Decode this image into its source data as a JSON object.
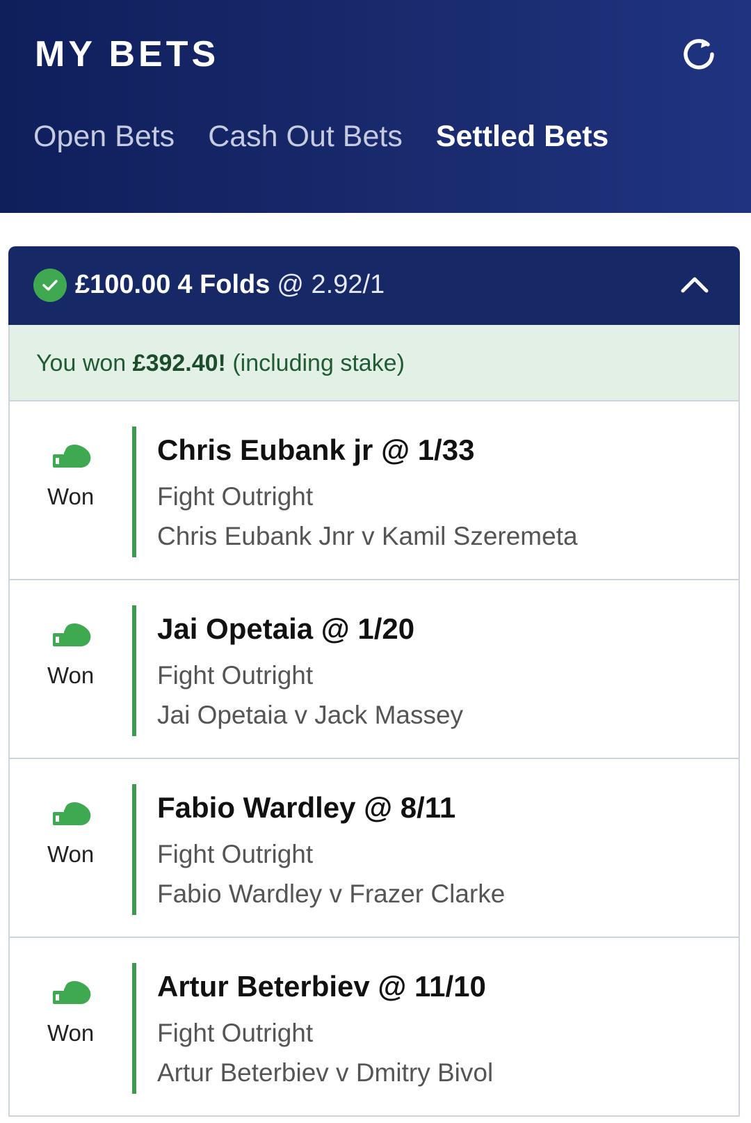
{
  "header": {
    "title": "MY BETS",
    "refresh_icon": "refresh-icon",
    "tabs": [
      {
        "label": "Open Bets",
        "active": false
      },
      {
        "label": "Cash Out Bets",
        "active": false
      },
      {
        "label": "Settled Bets",
        "active": true
      }
    ]
  },
  "bet": {
    "stake": "£100.00",
    "type": "4 Folds",
    "odds": "@ 2.92/1",
    "status_icon": "check-icon",
    "collapse_icon": "chevron-up-icon",
    "banner": {
      "prefix": "You won",
      "amount": "£392.40!",
      "suffix": "(including stake)"
    },
    "legs": [
      {
        "status": "Won",
        "selection": "Chris Eubank jr @ 1/33",
        "market": "Fight Outright",
        "event": "Chris Eubank Jnr v Kamil Szeremeta"
      },
      {
        "status": "Won",
        "selection": "Jai Opetaia @ 1/20",
        "market": "Fight Outright",
        "event": "Jai Opetaia v Jack Massey"
      },
      {
        "status": "Won",
        "selection": "Fabio Wardley @ 8/11",
        "market": "Fight Outright",
        "event": "Fabio Wardley v Frazer Clarke"
      },
      {
        "status": "Won",
        "selection": "Artur Beterbiev @ 11/10",
        "market": "Fight Outright",
        "event": "Artur Beterbiev v Dmitry Bivol"
      }
    ]
  },
  "colors": {
    "header_bg": "#172867",
    "win_green": "#3fa951",
    "banner_bg": "#e2f0e5"
  }
}
